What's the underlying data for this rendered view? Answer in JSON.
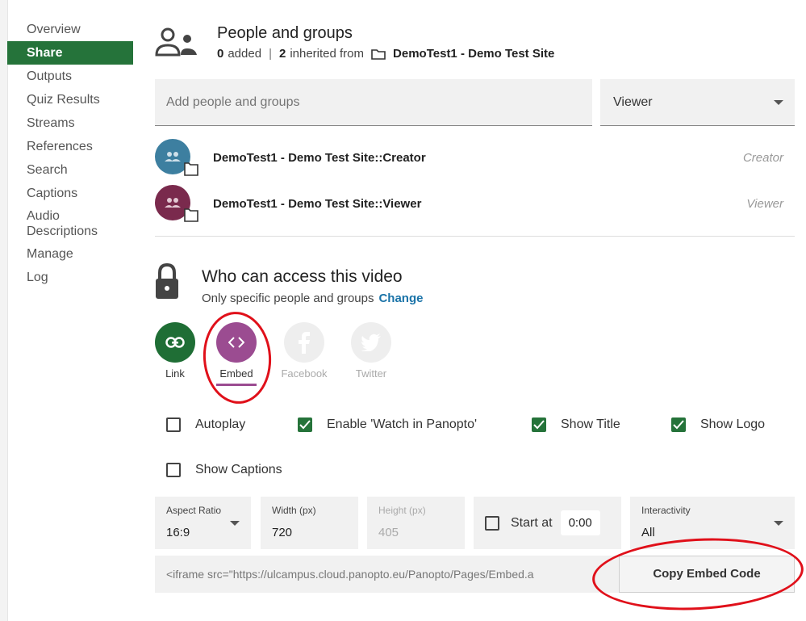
{
  "sidebar": {
    "items": [
      {
        "label": "Overview"
      },
      {
        "label": "Share"
      },
      {
        "label": "Outputs"
      },
      {
        "label": "Quiz Results"
      },
      {
        "label": "Streams"
      },
      {
        "label": "References"
      },
      {
        "label": "Search"
      },
      {
        "label": "Captions"
      },
      {
        "label": "Audio Descriptions"
      },
      {
        "label": "Manage"
      },
      {
        "label": "Log"
      }
    ],
    "active": "Share"
  },
  "people": {
    "title": "People and groups",
    "added_count": "0",
    "added_text": "added",
    "separator": "|",
    "inherited_count": "2",
    "inherited_text": "inherited from",
    "site_name": "DemoTest1 - Demo Test Site",
    "add_placeholder": "Add people and groups",
    "role_selected": "Viewer",
    "rows": [
      {
        "name": "DemoTest1 - Demo Test Site::Creator",
        "role": "Creator",
        "color": "#3d7fa0"
      },
      {
        "name": "DemoTest1 - Demo Test Site::Viewer",
        "role": "Viewer",
        "color": "#7a2a4d"
      }
    ]
  },
  "access": {
    "title": "Who can access this video",
    "subtitle": "Only specific people and groups",
    "change_link": "Change"
  },
  "share_options": [
    {
      "label": "Link",
      "color": "#1f6e35",
      "icon": "link-icon"
    },
    {
      "label": "Embed",
      "color": "#9b4c91",
      "icon": "code-icon"
    },
    {
      "label": "Facebook",
      "color": "#eeeeee",
      "icon": "facebook-icon"
    },
    {
      "label": "Twitter",
      "color": "#eeeeee",
      "icon": "twitter-icon"
    }
  ],
  "checkboxes": [
    {
      "label": "Autoplay",
      "checked": false
    },
    {
      "label": "Enable 'Watch in Panopto'",
      "checked": true
    },
    {
      "label": "Show Title",
      "checked": true
    },
    {
      "label": "Show Logo",
      "checked": true
    },
    {
      "label": "Show Captions",
      "checked": false
    }
  ],
  "embed_fields": {
    "aspect_ratio_label": "Aspect Ratio",
    "aspect_ratio_value": "16:9",
    "width_label": "Width (px)",
    "width_value": "720",
    "height_label": "Height (px)",
    "height_value": "405",
    "start_at_label": "Start at",
    "start_at_value": "0:00",
    "interactivity_label": "Interactivity",
    "interactivity_value": "All"
  },
  "embed_code": "<iframe src=\"https://ulcampus.cloud.panopto.eu/Panopto/Pages/Embed.a",
  "copy_button": "Copy Embed Code",
  "colors": {
    "accent_green": "#25733a",
    "embed_purple": "#9b4c91",
    "link_blue": "#1a73a8",
    "annotation_red": "#e0101a"
  }
}
